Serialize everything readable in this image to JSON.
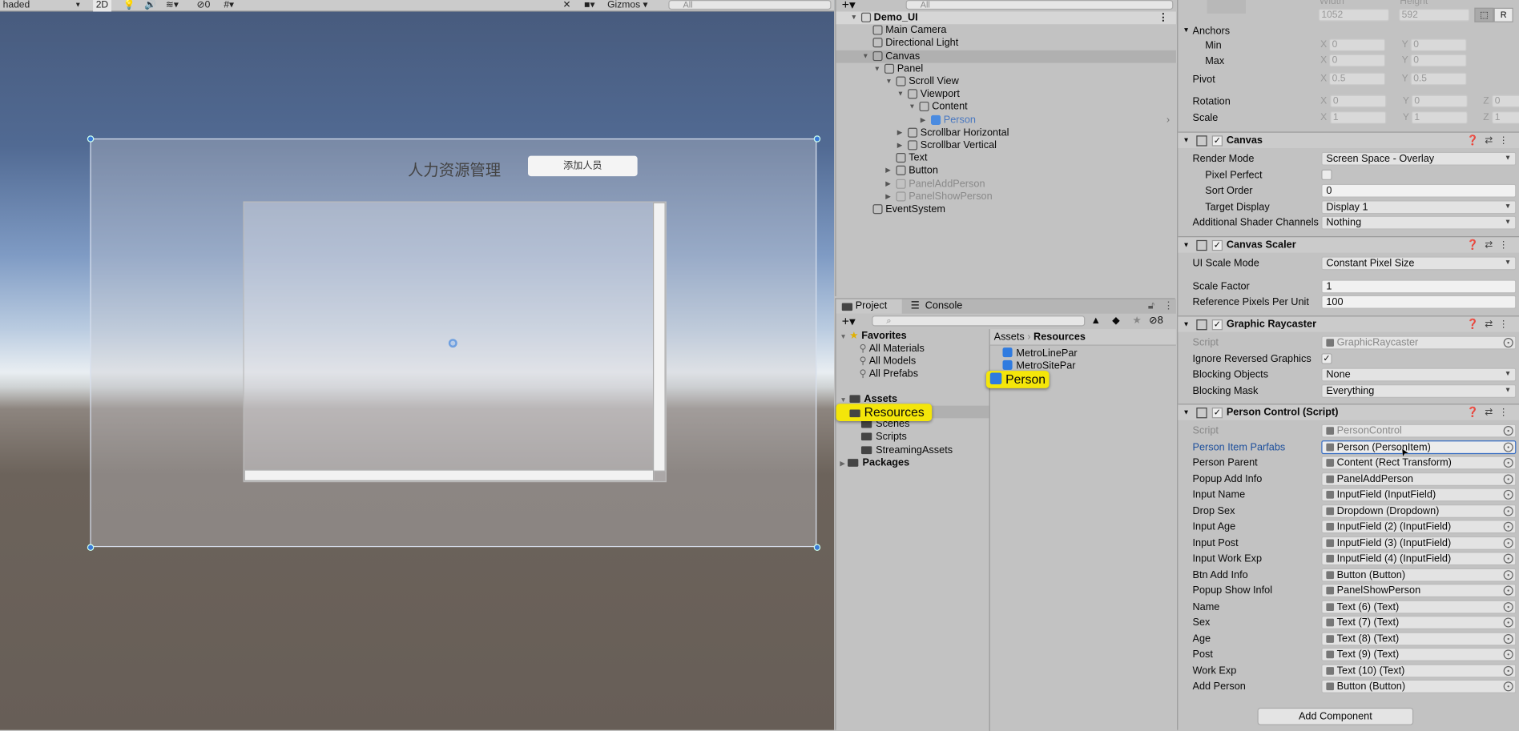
{
  "scene": {
    "toolbar": {
      "shading": "haded",
      "mode_2d": "2D",
      "hidden_count": "0",
      "gizmos": "Gizmos",
      "search_placeholder": "All"
    },
    "ui_title": "人力资源管理",
    "ui_add_button": "添加人员"
  },
  "hierarchy": {
    "search_placeholder": "All",
    "items": [
      {
        "label": "Demo_UI",
        "depth": 0,
        "arrow": "down",
        "scene": true
      },
      {
        "label": "Main Camera",
        "depth": 1
      },
      {
        "label": "Directional Light",
        "depth": 1
      },
      {
        "label": "Canvas",
        "depth": 1,
        "arrow": "down",
        "selected": true
      },
      {
        "label": "Panel",
        "depth": 2,
        "arrow": "down"
      },
      {
        "label": "Scroll View",
        "depth": 3,
        "arrow": "down"
      },
      {
        "label": "Viewport",
        "depth": 4,
        "arrow": "down"
      },
      {
        "label": "Content",
        "depth": 5,
        "arrow": "down"
      },
      {
        "label": "Person",
        "depth": 6,
        "arrow": "right",
        "prefab": true
      },
      {
        "label": "Scrollbar Horizontal",
        "depth": 4,
        "arrow": "right"
      },
      {
        "label": "Scrollbar Vertical",
        "depth": 4,
        "arrow": "right"
      },
      {
        "label": "Text",
        "depth": 3
      },
      {
        "label": "Button",
        "depth": 3,
        "arrow": "right"
      },
      {
        "label": "PanelAddPerson",
        "depth": 3,
        "arrow": "right",
        "inactive": true
      },
      {
        "label": "PanelShowPerson",
        "depth": 3,
        "arrow": "right",
        "inactive": true
      },
      {
        "label": "EventSystem",
        "depth": 1
      }
    ]
  },
  "project": {
    "tabs": [
      {
        "label": "Project",
        "active": true
      },
      {
        "label": "Console"
      }
    ],
    "hidden_count": "8",
    "favorites": {
      "label": "Favorites",
      "items": [
        "All Materials",
        "All Models",
        "All Prefabs"
      ]
    },
    "assets": {
      "label": "Assets",
      "items": [
        "Resources",
        "Scenes",
        "Scripts",
        "StreamingAssets"
      ]
    },
    "packages": "Packages",
    "breadcrumb": [
      "Assets",
      "Resources"
    ],
    "files": [
      "MetroLinePar",
      "MetroSitePar",
      "Person"
    ],
    "highlight_color": "#f4e60a"
  },
  "inspector": {
    "rect": {
      "width_label": "Width",
      "height_label": "Height",
      "width": "1052",
      "height": "592",
      "anchors": "Anchors",
      "min": "Min",
      "max": "Max",
      "min_x": "0",
      "min_y": "0",
      "max_x": "0",
      "max_y": "0",
      "pivot": "Pivot",
      "pivot_x": "0.5",
      "pivot_y": "0.5",
      "rotation": "Rotation",
      "rot": [
        "0",
        "0",
        "0"
      ],
      "scale": "Scale",
      "scl": [
        "1",
        "1",
        "1"
      ],
      "raw_btn": "R"
    },
    "canvas": {
      "title": "Canvas",
      "rows": [
        {
          "k": "Render Mode",
          "v": "Screen Space - Overlay",
          "type": "dropdown"
        },
        {
          "k": "Pixel Perfect",
          "type": "check",
          "checked": false,
          "sub": true
        },
        {
          "k": "Sort Order",
          "v": "0",
          "type": "text",
          "sub": true
        },
        {
          "k": "Target Display",
          "v": "Display 1",
          "type": "dropdown",
          "sub": true
        },
        {
          "k": "Additional Shader Channels",
          "v": "Nothing",
          "type": "dropdown"
        }
      ]
    },
    "scaler": {
      "title": "Canvas Scaler",
      "rows": [
        {
          "k": "UI Scale Mode",
          "v": "Constant Pixel Size",
          "type": "dropdown"
        },
        {
          "k": "Scale Factor",
          "v": "1",
          "type": "text"
        },
        {
          "k": "Reference Pixels Per Unit",
          "v": "100",
          "type": "text"
        }
      ]
    },
    "raycaster": {
      "title": "Graphic Raycaster",
      "rows": [
        {
          "k": "Script",
          "v": "GraphicRaycaster",
          "type": "ref",
          "disabled": true
        },
        {
          "k": "Ignore Reversed Graphics",
          "type": "check",
          "checked": true
        },
        {
          "k": "Blocking Objects",
          "v": "None",
          "type": "dropdown"
        },
        {
          "k": "Blocking Mask",
          "v": "Everything",
          "type": "dropdown"
        }
      ]
    },
    "person_control": {
      "title": "Person Control (Script)",
      "rows": [
        {
          "k": "Script",
          "v": "PersonControl",
          "type": "ref",
          "disabled": true
        },
        {
          "k": "Person Item Parfabs",
          "v": "Person (PersonItem)",
          "type": "ref",
          "focused": true
        },
        {
          "k": "Person Parent",
          "v": "Content (Rect Transform)",
          "type": "ref"
        },
        {
          "k": "Popup Add Info",
          "v": "PanelAddPerson",
          "type": "ref"
        },
        {
          "k": "Input Name",
          "v": "InputField (InputField)",
          "type": "ref"
        },
        {
          "k": "Drop Sex",
          "v": "Dropdown (Dropdown)",
          "type": "ref"
        },
        {
          "k": "Input Age",
          "v": "InputField (2) (InputField)",
          "type": "ref"
        },
        {
          "k": "Input Post",
          "v": "InputField (3) (InputField)",
          "type": "ref"
        },
        {
          "k": "Input Work Exp",
          "v": "InputField (4) (InputField)",
          "type": "ref"
        },
        {
          "k": "Btn Add Info",
          "v": "Button (Button)",
          "type": "ref"
        },
        {
          "k": "Popup Show Infol",
          "v": "PanelShowPerson",
          "type": "ref"
        },
        {
          "k": "Name",
          "v": "Text (6) (Text)",
          "type": "ref"
        },
        {
          "k": "Sex",
          "v": "Text (7) (Text)",
          "type": "ref"
        },
        {
          "k": "Age",
          "v": "Text (8) (Text)",
          "type": "ref"
        },
        {
          "k": "Post",
          "v": "Text (9) (Text)",
          "type": "ref"
        },
        {
          "k": "Work Exp",
          "v": "Text (10) (Text)",
          "type": "ref"
        },
        {
          "k": "Add Person",
          "v": "Button (Button)",
          "type": "ref"
        }
      ]
    },
    "add_component": "Add Component",
    "focus_label_color": "#1d4f9c"
  }
}
